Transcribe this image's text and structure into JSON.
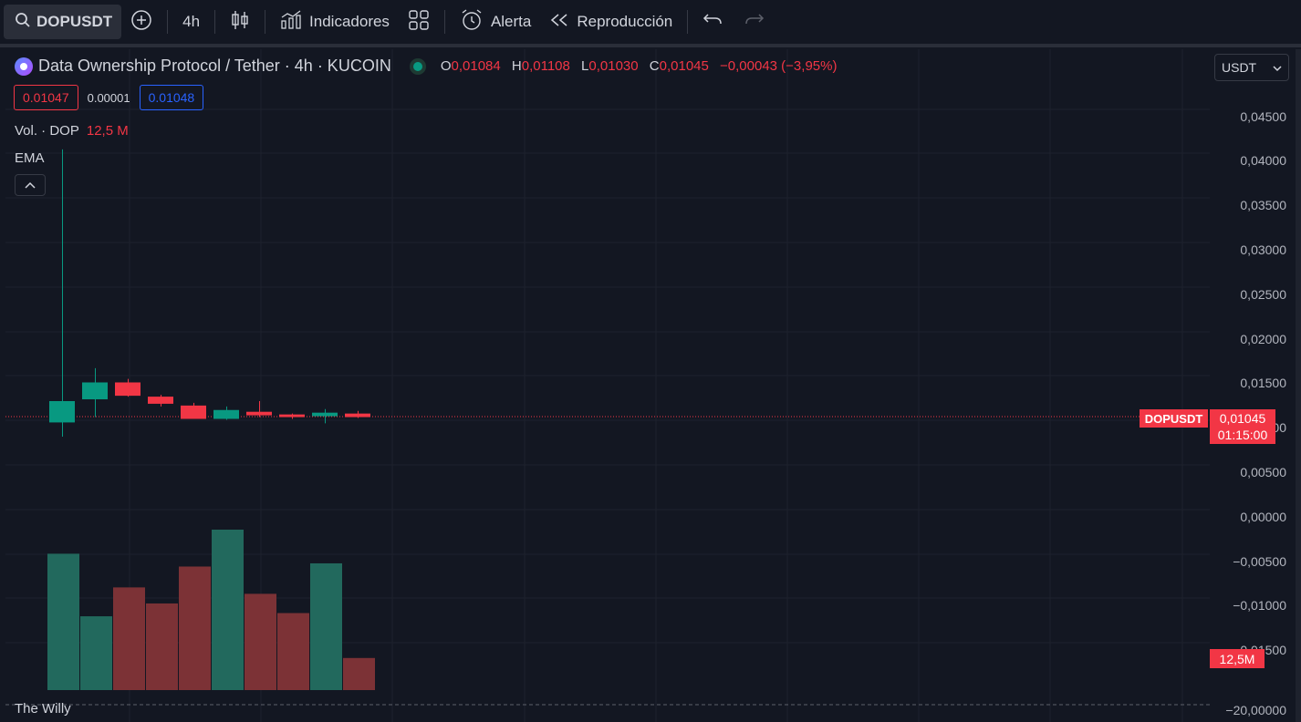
{
  "toolbar": {
    "symbol": "DOPUSDT",
    "interval": "4h",
    "indicators_label": "Indicadores",
    "alert_label": "Alerta",
    "replay_label": "Reproducción"
  },
  "legend": {
    "title": "Data Ownership Protocol / Tether · 4h · KUCOIN",
    "o_key": "O",
    "o_val": "0,01084",
    "h_key": "H",
    "h_val": "0,01108",
    "l_key": "L",
    "l_val": "0,01030",
    "c_key": "C",
    "c_val": "0,01045",
    "change": "−0,00043 (−3,95%)"
  },
  "quote": {
    "sell": "0.01047",
    "spread": "0.00001",
    "buy": "0.01048"
  },
  "volume_legend": {
    "label": "Vol. · DOP",
    "value": "12,5 M"
  },
  "ema_label": "EMA",
  "currency_select": "USDT",
  "price_axis_ticks": [
    "0,04500",
    "0,04000",
    "0,03500",
    "0,03000",
    "0,02500",
    "0,02000",
    "0,01500",
    "0,01000",
    "0,00500",
    "0,00000",
    "−0,00500",
    "−0,01000",
    "−0,01500",
    "−20,00000"
  ],
  "price_tag": {
    "symbol": "DOPUSDT",
    "price": "0,01045",
    "countdown": "01:15:00"
  },
  "volume_tag": "12,5M",
  "indicator_pane_label": "The Willy",
  "colors": {
    "up": "#089981",
    "down": "#f23645",
    "vol_up": "#22695d",
    "vol_down": "#7c3236",
    "background": "#131722",
    "grid": "#1e222d"
  },
  "chart_data": {
    "type": "candlestick",
    "ylim": [
      -0.0165,
      0.0495
    ],
    "candles": [
      {
        "o": 0.0098,
        "h": 0.0405,
        "l": 0.0082,
        "c": 0.0122
      },
      {
        "o": 0.0124,
        "h": 0.0159,
        "l": 0.0104,
        "c": 0.0143
      },
      {
        "o": 0.0143,
        "h": 0.0147,
        "l": 0.0127,
        "c": 0.0128
      },
      {
        "o": 0.0127,
        "h": 0.0129,
        "l": 0.0116,
        "c": 0.0119
      },
      {
        "o": 0.0117,
        "h": 0.012,
        "l": 0.0102,
        "c": 0.0102
      },
      {
        "o": 0.0102,
        "h": 0.0116,
        "l": 0.0101,
        "c": 0.0112
      },
      {
        "o": 0.011,
        "h": 0.0122,
        "l": 0.0104,
        "c": 0.0106
      },
      {
        "o": 0.0107,
        "h": 0.0108,
        "l": 0.0102,
        "c": 0.0104
      },
      {
        "o": 0.0105,
        "h": 0.0113,
        "l": 0.0097,
        "c": 0.0109
      },
      {
        "o": 0.0108,
        "h": 0.0111,
        "l": 0.0103,
        "c": 0.0104
      }
    ],
    "volume": [
      {
        "v": 0.85,
        "dir": "up"
      },
      {
        "v": 0.46,
        "dir": "up"
      },
      {
        "v": 0.64,
        "dir": "down"
      },
      {
        "v": 0.54,
        "dir": "down"
      },
      {
        "v": 0.77,
        "dir": "down"
      },
      {
        "v": 1.0,
        "dir": "up"
      },
      {
        "v": 0.6,
        "dir": "down"
      },
      {
        "v": 0.48,
        "dir": "down"
      },
      {
        "v": 0.79,
        "dir": "up"
      },
      {
        "v": 0.2,
        "dir": "down"
      }
    ],
    "last_price": 0.01045
  }
}
